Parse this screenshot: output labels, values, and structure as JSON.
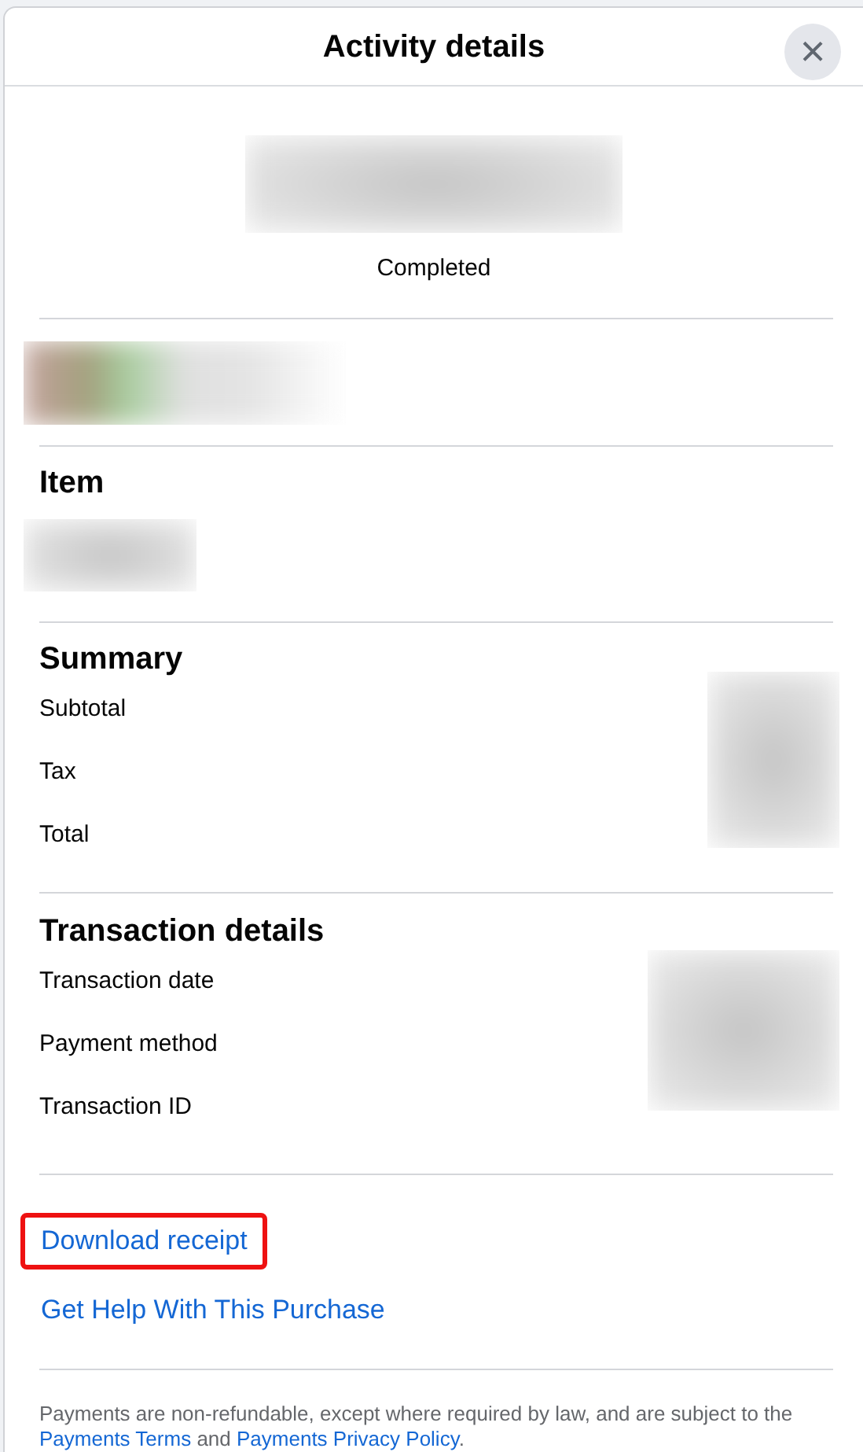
{
  "dialog": {
    "title": "Activity details",
    "close": "×"
  },
  "status": "Completed",
  "item": {
    "heading": "Item"
  },
  "summary": {
    "heading": "Summary",
    "rows": [
      "Subtotal",
      "Tax",
      "Total"
    ]
  },
  "transaction": {
    "heading": "Transaction details",
    "rows": [
      "Transaction date",
      "Payment method",
      "Transaction ID"
    ]
  },
  "links": [
    {
      "text": "Download receipt",
      "highlighted": true
    },
    {
      "text": "Get Help With This Purchase",
      "highlighted": false
    }
  ],
  "footer": [
    {
      "kind": "text",
      "text": "Payments are non-refundable, except where required by law, and are subject to the "
    },
    {
      "kind": "link",
      "text": "Payments Terms"
    },
    {
      "kind": "text",
      "text": " and "
    },
    {
      "kind": "link",
      "text": "Payments Privacy Policy"
    },
    {
      "kind": "text",
      "text": "."
    }
  ]
}
